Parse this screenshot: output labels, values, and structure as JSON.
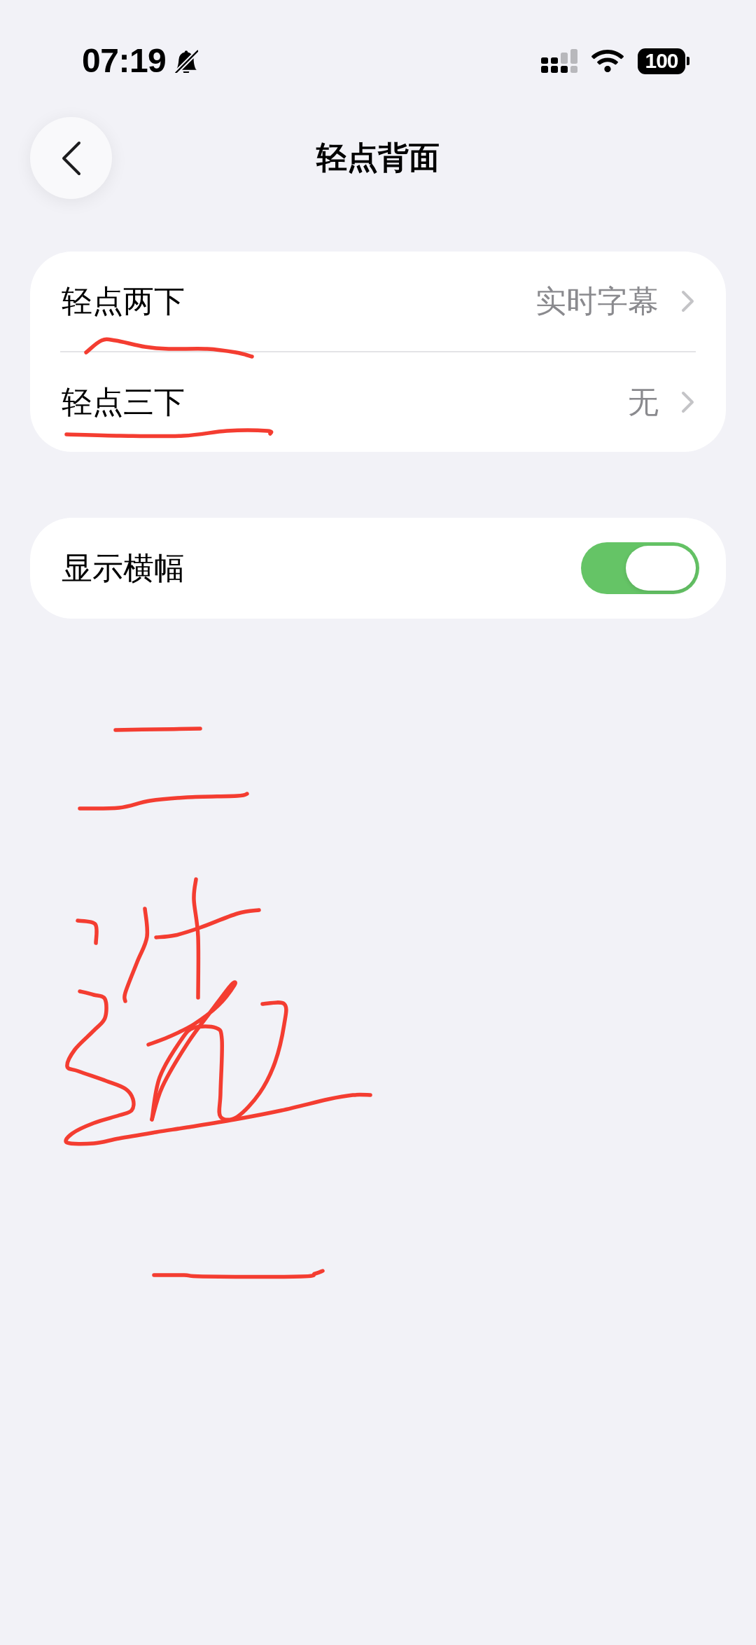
{
  "status_bar": {
    "time": "07:19",
    "silent": true,
    "battery": "100"
  },
  "nav": {
    "title": "轻点背面"
  },
  "tap_actions": [
    {
      "label": "轻点两下",
      "value": "实时字幕"
    },
    {
      "label": "轻点三下",
      "value": "无"
    }
  ],
  "settings": [
    {
      "label": "显示横幅",
      "on": true
    }
  ]
}
